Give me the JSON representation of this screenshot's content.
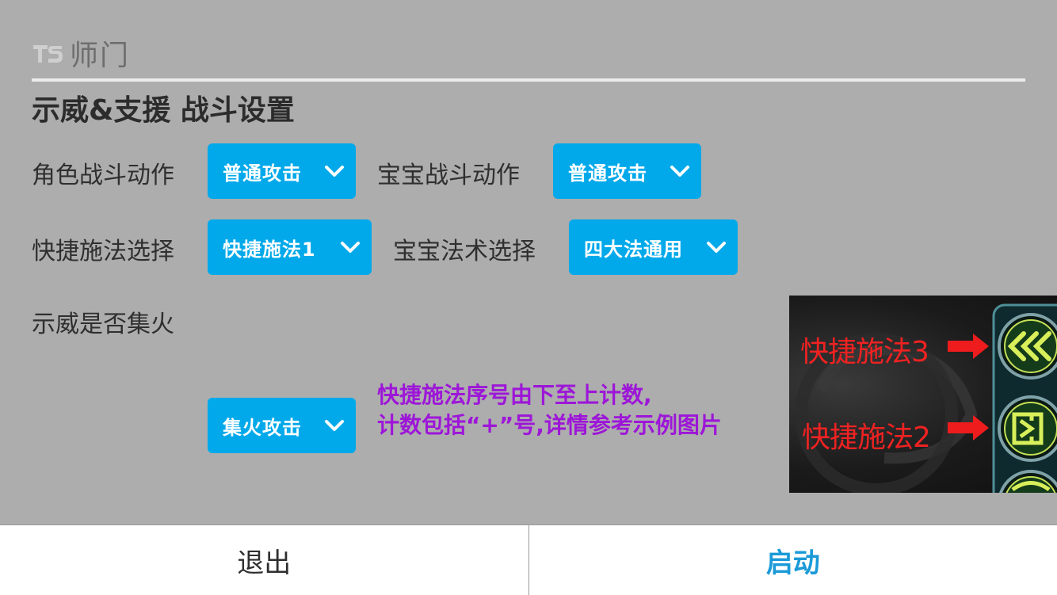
{
  "header": {
    "title": "师门",
    "logo_icon": "ts-logo-icon"
  },
  "section_title": "示威&支援 战斗设置",
  "settings": {
    "role_action": {
      "label": "角色战斗动作",
      "value": "普通攻击"
    },
    "pet_action": {
      "label": "宝宝战斗动作",
      "value": "普通攻击"
    },
    "quick_spell": {
      "label": "快捷施法选择",
      "value": "快捷施法1"
    },
    "pet_spell": {
      "label": "宝宝法术选择",
      "value": "四大法通用"
    },
    "focus_fire": {
      "label": "示威是否集火",
      "value": "集火攻击"
    }
  },
  "hint": {
    "line1": "快捷施法序号由下至上计数,",
    "line2": "计数包括“+”号,详情参考示例图片"
  },
  "example_image": {
    "label_top": "快捷施法3",
    "label_bottom": "快捷施法2"
  },
  "footer": {
    "exit_label": "退出",
    "start_label": "启动"
  },
  "colors": {
    "background": "#adadad",
    "dropdown": "#01a9ea",
    "hint_text": "#9d16d8",
    "start_text": "#1a9ad8",
    "example_label": "#ee2222"
  }
}
